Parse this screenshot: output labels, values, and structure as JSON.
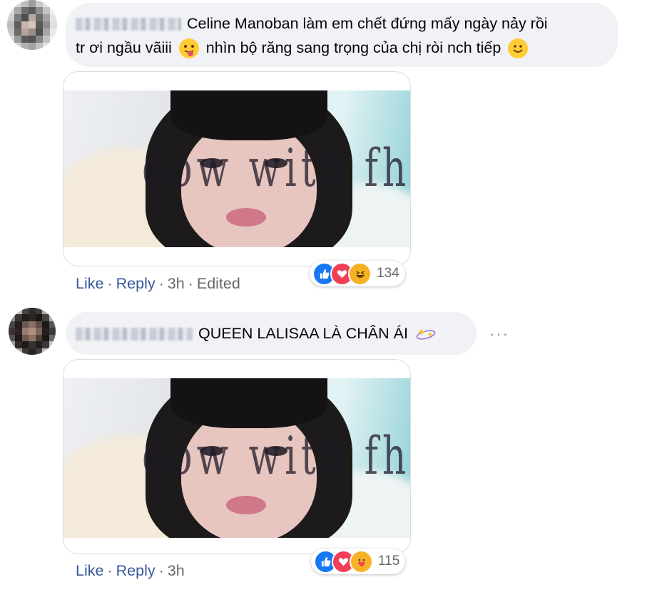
{
  "comments": [
    {
      "author_blurred": "",
      "text_line1": "Celine Manoban làm em chết đứng mấy ngày nảy rồi",
      "text_line2_a": "tr ơi ngầu vãiii",
      "text_line2_b": "nhìn bộ răng sang trọng của chị ròi nch tiếp",
      "emoji_1": "tongue-out-emoji",
      "emoji_2": "smile-emoji",
      "media_overlay_text": "dow with fha t",
      "actions": {
        "like": "Like",
        "reply": "Reply",
        "time": "3h",
        "edited": "Edited",
        "dot": "·"
      },
      "reactions": {
        "icons": [
          "like-reaction",
          "love-reaction",
          "haha-reaction"
        ],
        "count": "134"
      }
    },
    {
      "author_blurred": "",
      "text": "QUEEN LALISAA LÀ CHÂN ÁI",
      "emoji": "sparkle-stars-emoji",
      "media_overlay_text": "dow with fha t",
      "more_label": "···",
      "actions": {
        "like": "Like",
        "reply": "Reply",
        "time": "3h",
        "dot": "·"
      },
      "reactions": {
        "icons": [
          "like-reaction",
          "love-reaction",
          "care-reaction"
        ],
        "count": "115"
      }
    }
  ],
  "colors": {
    "bubble": "#f0f2f5",
    "link": "#385898",
    "meta": "#65676b",
    "like": "#1877f2",
    "love": "#f33e58",
    "haha": "#f7b125"
  }
}
